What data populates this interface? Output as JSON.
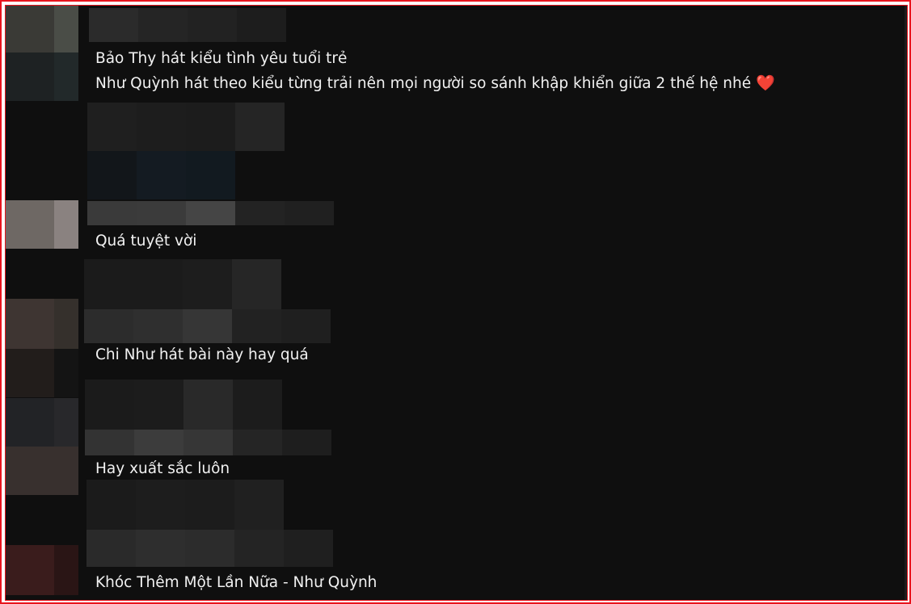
{
  "comments": [
    {
      "lines": [
        "Bảo Thy hát kiểu tình yêu tuổi trẻ",
        "Như Quỳnh hát theo kiểu từng trải nên mọi người so sánh khập khiển giữa 2 thế hệ nhé"
      ],
      "emoji": "heart-icon"
    },
    {
      "lines": [
        "Quá tuyệt vời"
      ]
    },
    {
      "lines": [
        "Chi Như hát bài này hay quá"
      ]
    },
    {
      "lines": [
        "Hay xuất sắc luôn"
      ]
    },
    {
      "lines": [
        "Khóc Thêm Một Lần Nữa - Như Quỳnh"
      ]
    }
  ],
  "colors": {
    "frame_border": "#e8141d",
    "background": "#0f0f0f",
    "text": "#f1f1f1",
    "heart": "#e53935"
  }
}
